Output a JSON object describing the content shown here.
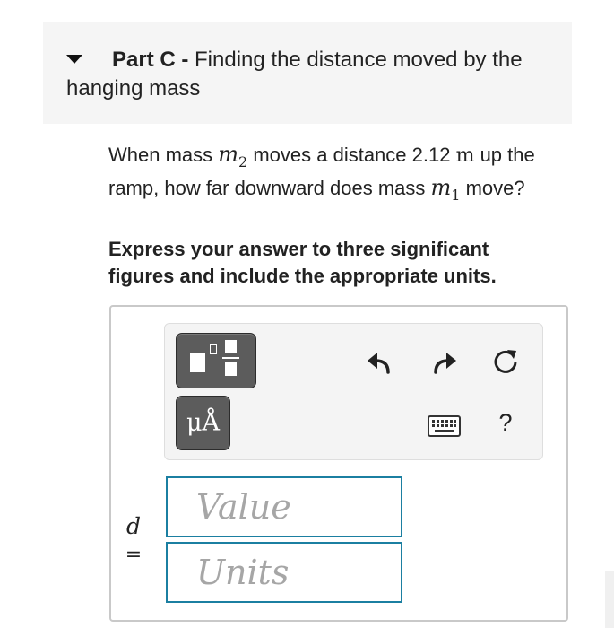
{
  "part": {
    "label": "Part C - ",
    "title": "Finding the distance moved by the hanging mass"
  },
  "question": {
    "t1": "When mass ",
    "m2_var": "m",
    "m2_sub": "2",
    "t2": " moves a distance 2.12 ",
    "unit": "m",
    "t3": " up the ramp, how far downward does mass ",
    "m1_var": "m",
    "m1_sub": "1",
    "t4": " move?"
  },
  "instruction": "Express your answer to three significant figures and include the appropriate units.",
  "toolbar": {
    "templates_icon": "fraction-templates-icon",
    "units_button_label": "μÅ",
    "undo_icon": "undo-icon",
    "redo_icon": "redo-icon",
    "reset_icon": "reset-icon",
    "keyboard_icon": "keyboard-icon",
    "help_label": "?"
  },
  "answer": {
    "variable": "d",
    "equals": "=",
    "value_placeholder": "Value",
    "units_placeholder": "Units"
  },
  "colors": {
    "field_border": "#1b7fa1",
    "button_dark": "#5c5c5c",
    "header_bg": "#f5f5f5"
  }
}
